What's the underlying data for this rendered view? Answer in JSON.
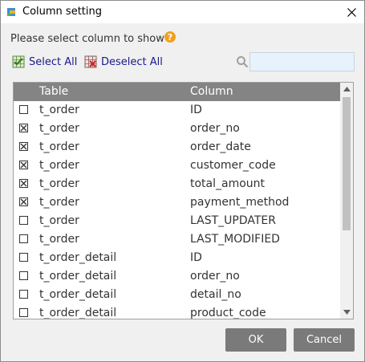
{
  "window": {
    "title": "Column setting"
  },
  "prompt": "Please select column to show",
  "actions": {
    "select_all": "Select All",
    "deselect_all": "Deselect All"
  },
  "search": {
    "value": "",
    "placeholder": ""
  },
  "grid": {
    "headers": {
      "table": "Table",
      "column": "Column"
    },
    "rows": [
      {
        "checked": false,
        "table": "t_order",
        "column": "ID"
      },
      {
        "checked": true,
        "table": "t_order",
        "column": "order_no"
      },
      {
        "checked": true,
        "table": "t_order",
        "column": "order_date"
      },
      {
        "checked": true,
        "table": "t_order",
        "column": "customer_code"
      },
      {
        "checked": true,
        "table": "t_order",
        "column": "total_amount"
      },
      {
        "checked": true,
        "table": "t_order",
        "column": "payment_method"
      },
      {
        "checked": false,
        "table": "t_order",
        "column": "LAST_UPDATER"
      },
      {
        "checked": false,
        "table": "t_order",
        "column": "LAST_MODIFIED"
      },
      {
        "checked": false,
        "table": "t_order_detail",
        "column": "ID"
      },
      {
        "checked": false,
        "table": "t_order_detail",
        "column": "order_no"
      },
      {
        "checked": false,
        "table": "t_order_detail",
        "column": "detail_no"
      },
      {
        "checked": false,
        "table": "t_order_detail",
        "column": "product_code"
      }
    ]
  },
  "buttons": {
    "ok": "OK",
    "cancel": "Cancel"
  },
  "colors": {
    "header_bg": "#848484",
    "button_bg": "#7a7a7a",
    "link": "#1a1a8c",
    "help": "#f0a020",
    "search_bg": "#e8f2fc"
  }
}
